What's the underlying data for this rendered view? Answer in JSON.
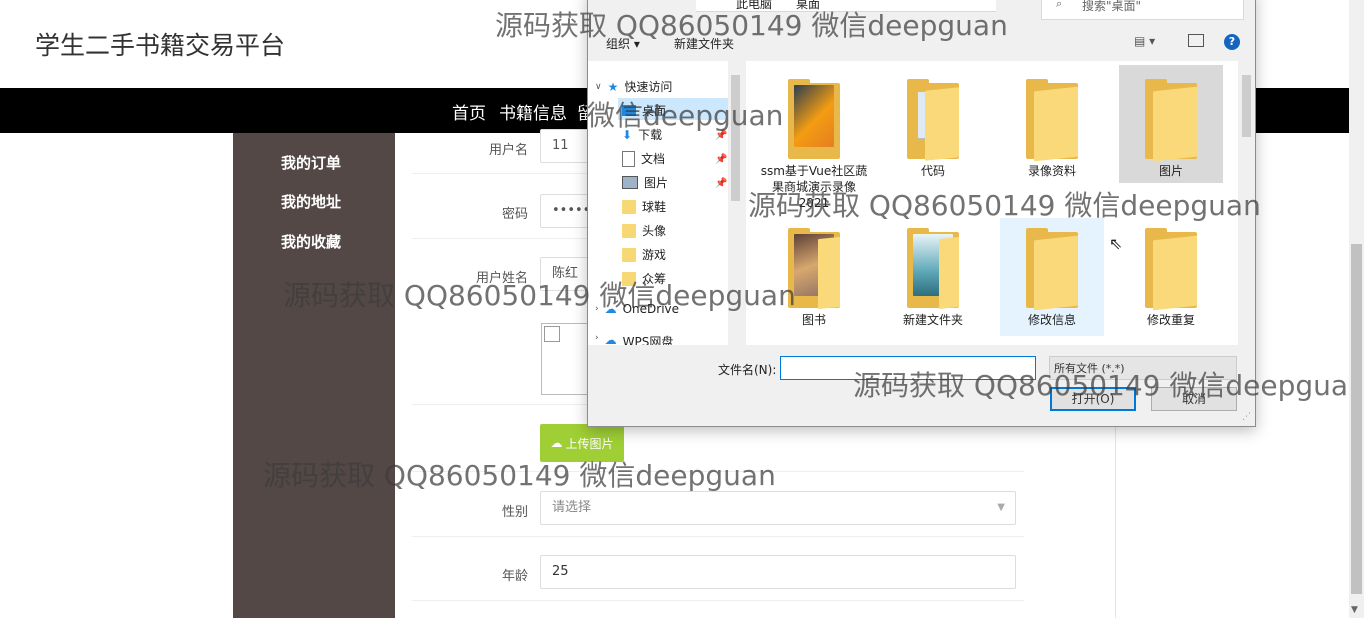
{
  "site": {
    "title": "学生二手书籍交易平台"
  },
  "nav": {
    "items": [
      "首页",
      "书籍信息",
      "留"
    ]
  },
  "sidebar": {
    "items": [
      "我的订单",
      "我的地址",
      "我的收藏"
    ]
  },
  "form": {
    "username_label": "用户名",
    "username_value": "11",
    "password_label": "密码",
    "password_value": "••••••",
    "realname_label": "用户姓名",
    "realname_value": "陈红",
    "upload_label": "上传图片",
    "gender_label": "性别",
    "gender_placeholder": "请选择",
    "age_label": "年龄",
    "age_value": "25"
  },
  "dialog": {
    "breadcrumb": [
      "此电脑",
      "桌面"
    ],
    "search_placeholder": "搜索\"桌面\"",
    "toolbar": {
      "organize": "组织 ▾",
      "new_folder": "新建文件夹"
    },
    "tree": {
      "quick_access": "快速访问",
      "items": [
        "桌面",
        "下载",
        "文档",
        "图片",
        "球鞋",
        "头像",
        "游戏",
        "众筹"
      ],
      "onedrive": "OneDrive",
      "wps": "WPS网盘"
    },
    "files": [
      {
        "name": "ssm基于Vue社区蔬果商城演示录像2021",
        "kind": "thumb-orange"
      },
      {
        "name": "代码",
        "kind": "folder-doc"
      },
      {
        "name": "录像资料",
        "kind": "folder"
      },
      {
        "name": "图片",
        "kind": "folder",
        "selected": true
      },
      {
        "name": "图书",
        "kind": "thumb-food"
      },
      {
        "name": "新建文件夹",
        "kind": "thumb-web"
      },
      {
        "name": "修改信息",
        "kind": "folder",
        "hover": true
      },
      {
        "name": "修改重复",
        "kind": "folder"
      }
    ],
    "filename_label": "文件名(N):",
    "filetype": "所有文件 (*.*)",
    "open": "打开(O)",
    "cancel": "取消"
  },
  "watermarks": [
    "源码获取 QQ86050149 微信deepguan",
    "微信deepguan",
    "源码获取 QQ86050149 微信deepguan",
    "源码获取 QQ86050149 微信deepguan",
    "源码获取 QQ86050149 微信deepgua",
    "源码获取 QQ86050149 微信deepguan"
  ],
  "colors": {
    "navbar": "#000000",
    "sidebar": "#534846",
    "upload": "#9fcf35",
    "dialog_accent": "#0078d7"
  }
}
